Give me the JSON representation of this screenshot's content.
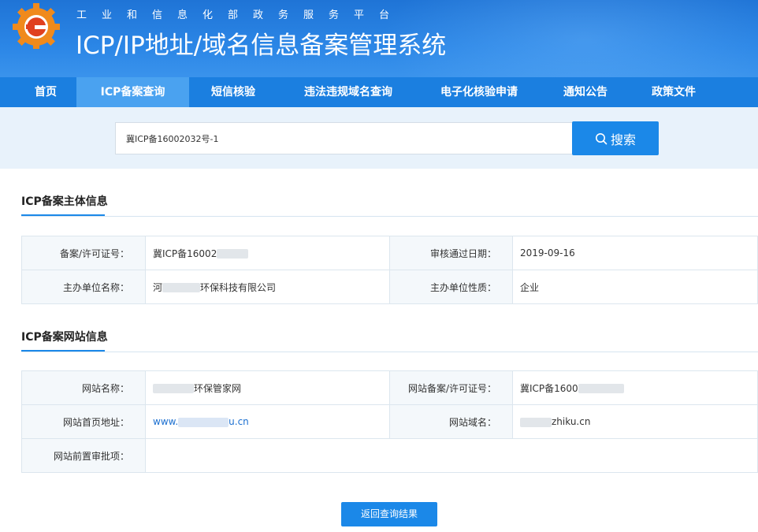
{
  "header": {
    "subtitle": "工业和信息化部政务服务平台",
    "title": "ICP/IP地址/域名信息备案管理系统"
  },
  "nav": {
    "items": [
      {
        "label": "首页"
      },
      {
        "label": "ICP备案查询"
      },
      {
        "label": "短信核验"
      },
      {
        "label": "违法违规域名查询"
      },
      {
        "label": "电子化核验申请"
      },
      {
        "label": "通知公告"
      },
      {
        "label": "政策文件"
      }
    ],
    "active": "ICP备案查询"
  },
  "search": {
    "value": "冀ICP备16002032号-1",
    "button_label": "搜索",
    "icon": "search-icon"
  },
  "subject_info": {
    "heading": "ICP备案主体信息",
    "rows": [
      {
        "label1": "备案/许可证号：",
        "value1": "冀ICP备16002",
        "label2": "审核通过日期：",
        "value2": "2019-09-16"
      },
      {
        "label1": "主办单位名称：",
        "value1_prefix": "河",
        "value1": "环保科技有限公司",
        "label2": "主办单位性质：",
        "value2": "企业"
      }
    ]
  },
  "site_info": {
    "heading": "ICP备案网站信息",
    "rows": [
      {
        "label1": "网站名称：",
        "value1": "环保管家网",
        "label2": "网站备案/许可证号：",
        "value2": "冀ICP备1600"
      },
      {
        "label1": "网站首页地址：",
        "value1_prefix": "www.",
        "value1_suffix": "u.cn",
        "label2": "网站域名：",
        "value2": "zhiku.cn"
      },
      {
        "label1": "网站前置审批项：",
        "value1": ""
      }
    ]
  },
  "back_button": {
    "label": "返回查询结果"
  },
  "colors": {
    "primary": "#1b88e8",
    "nav_active": "#4aa2f0",
    "header": "#2b86e6"
  }
}
